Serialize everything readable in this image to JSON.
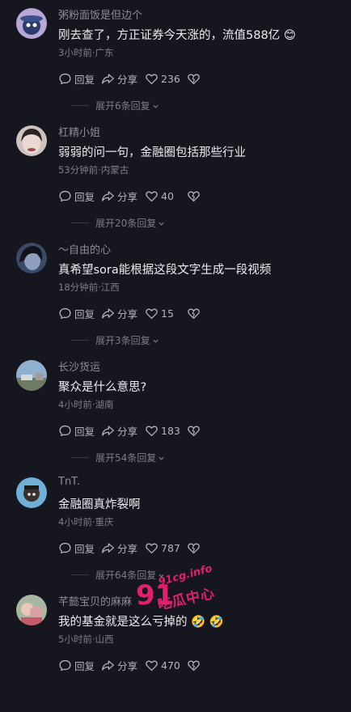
{
  "comments": [
    {
      "username": "粥粉面饭是但边个",
      "text": "刚去查了，方正证券今天涨的，流值588亿 😊",
      "time": "3小时前",
      "location": "广东",
      "reply": "回复",
      "share": "分享",
      "likes": "236",
      "expand": "展开6条回复"
    },
    {
      "username": "杠精小姐",
      "text": "弱弱的问一句，金融圈包括那些行业",
      "time": "53分钟前",
      "location": "内蒙古",
      "reply": "回复",
      "share": "分享",
      "likes": "40",
      "expand": "展开20条回复"
    },
    {
      "username": "〜自由的心",
      "text": "真希望sora能根据这段文字生成一段视频",
      "time": "18分钟前",
      "location": "江西",
      "reply": "回复",
      "share": "分享",
      "likes": "15",
      "expand": "展开3条回复"
    },
    {
      "username": "长沙货运",
      "text": "聚众是什么意思?",
      "time": "4小时前",
      "location": "湖南",
      "reply": "回复",
      "share": "分享",
      "likes": "183",
      "expand": "展开54条回复"
    },
    {
      "username": "TnT.",
      "text": "金融圈真炸裂啊",
      "time": "4小时前",
      "location": "重庆",
      "reply": "回复",
      "share": "分享",
      "likes": "787",
      "expand": "展开64条回复"
    },
    {
      "username": "芊懿宝贝的麻麻",
      "text": "我的基金就是这么亏掉的 🤣 🤣",
      "time": "5小时前",
      "location": "山西",
      "reply": "回复",
      "share": "分享",
      "likes": "470",
      "expand": ""
    }
  ],
  "meta_separator": "·",
  "watermark": {
    "number": "91",
    "site": "91cg.info",
    "name": "吃瓜中心"
  },
  "colors": {
    "background": "#16161e",
    "text": "#ececf0",
    "muted": "#7e7e88",
    "watermark": "#e0206e"
  },
  "icons": [
    "reply-icon",
    "share-icon",
    "heart-icon",
    "dislike-heart-icon",
    "chevron-down-icon"
  ]
}
